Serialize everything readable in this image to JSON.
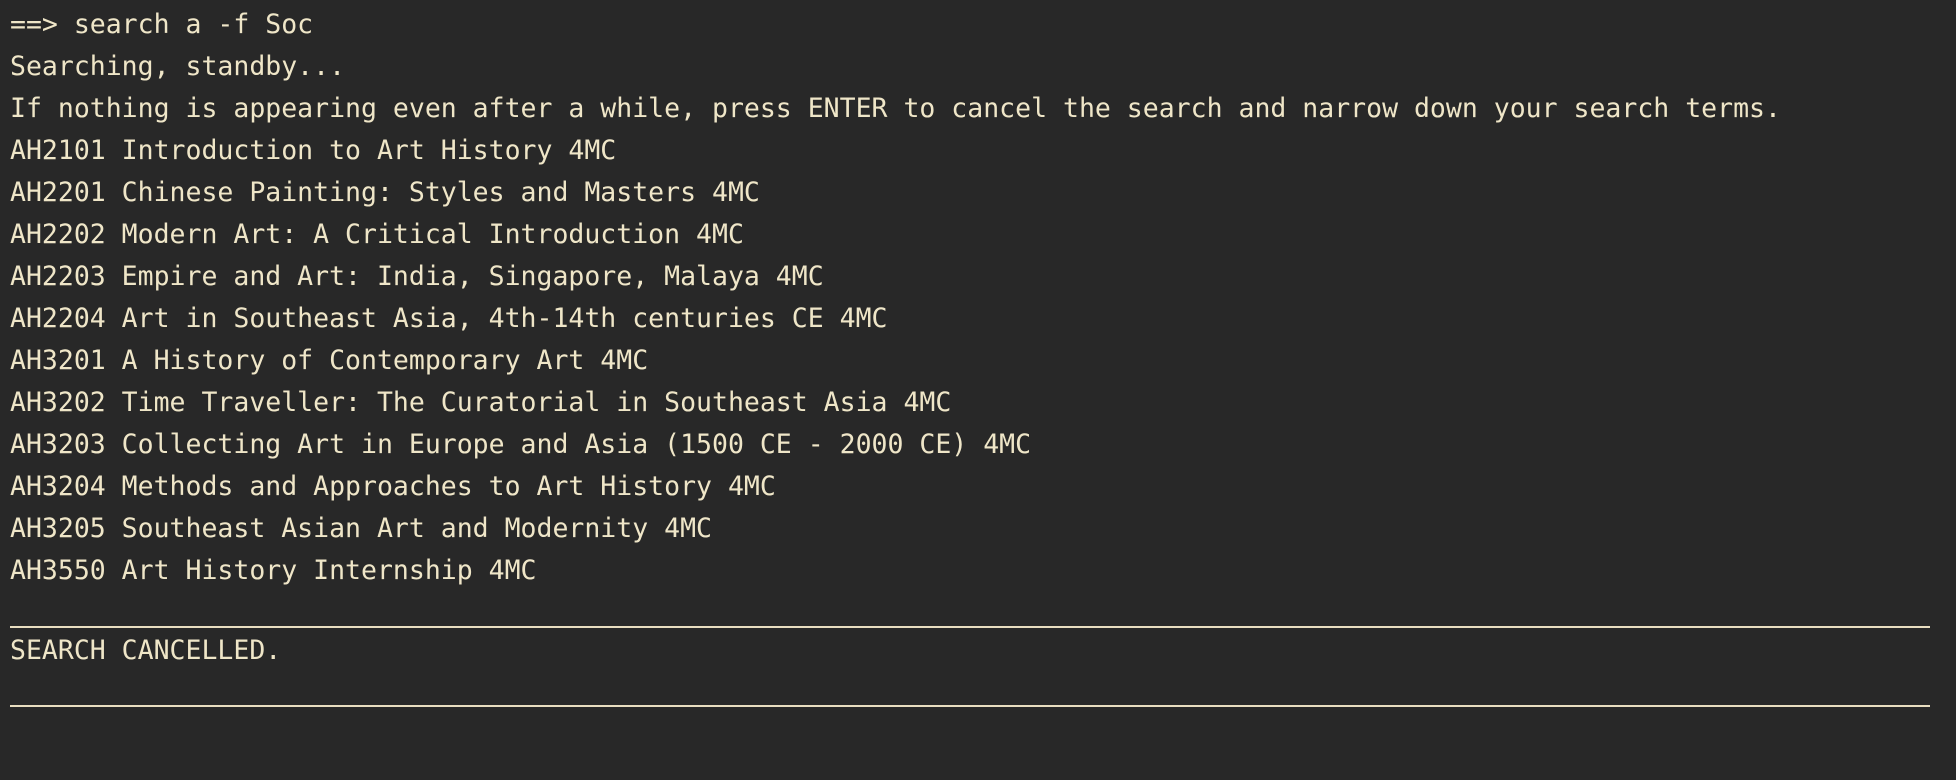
{
  "terminal": {
    "command_line": "==> search a -f Soc",
    "status_line": "Searching, standby...",
    "hint_line": "If nothing is appearing even after a while, press ENTER to cancel the search and narrow down your search terms.",
    "results": [
      "AH2101 Introduction to Art History 4MC",
      "AH2201 Chinese Painting: Styles and Masters 4MC",
      "AH2202 Modern Art: A Critical Introduction 4MC",
      "AH2203 Empire and Art: India, Singapore, Malaya 4MC",
      "AH2204 Art in Southeast Asia, 4th-14th centuries CE 4MC",
      "AH3201 A History of Contemporary Art 4MC",
      "AH3202 Time Traveller: The Curatorial in Southeast Asia 4MC",
      "AH3203 Collecting Art in Europe and Asia (1500 CE - 2000 CE) 4MC",
      "AH3204 Methods and Approaches to Art History 4MC",
      "AH3205 Southeast Asian Art and Modernity 4MC",
      "AH3550 Art History Internship 4MC"
    ],
    "cancel_message": "SEARCH CANCELLED.",
    "colors": {
      "background": "#282828",
      "foreground": "#efe6c8"
    }
  }
}
